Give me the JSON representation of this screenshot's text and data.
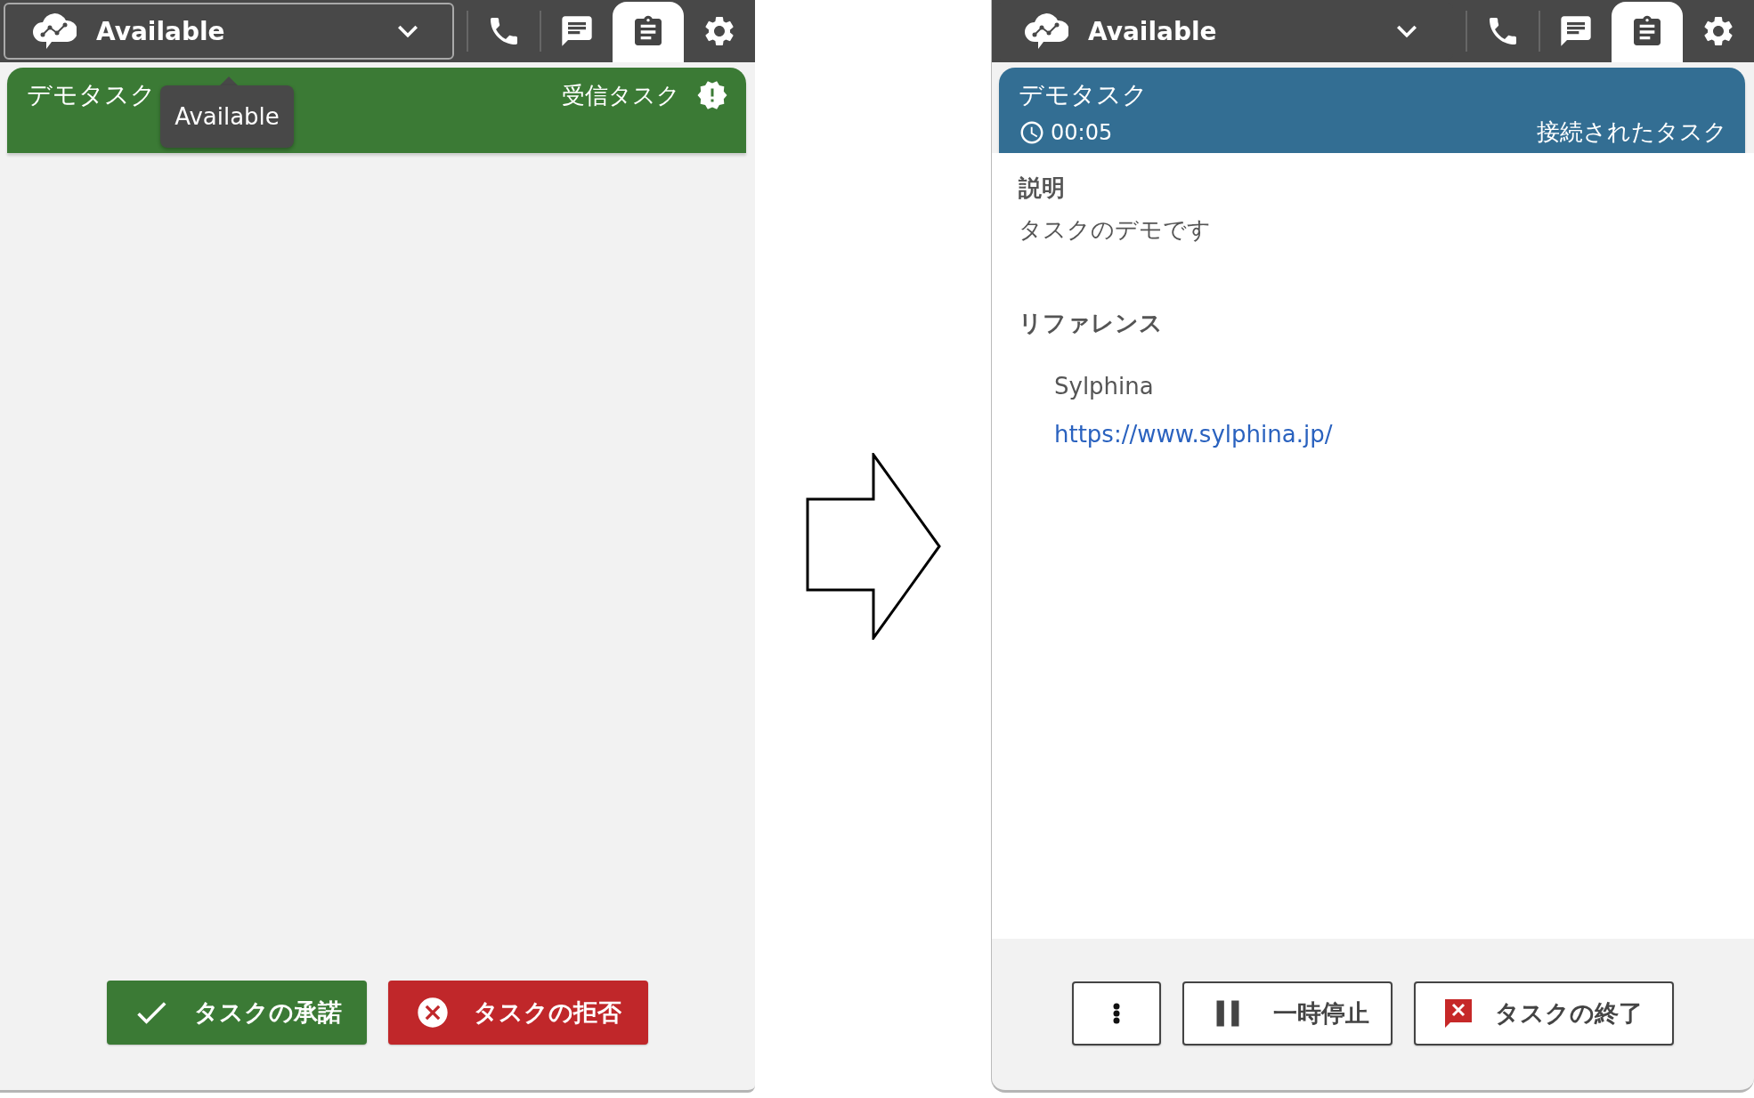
{
  "panels": [
    {
      "kind": "incoming",
      "status": {
        "label": "Available",
        "focused": true,
        "tooltip": "Available"
      },
      "tabs": [
        {
          "kind": "phone",
          "selected": false
        },
        {
          "kind": "chat",
          "selected": false
        },
        {
          "kind": "task",
          "selected": true
        },
        {
          "kind": "settings",
          "selected": false
        }
      ],
      "task": {
        "title": "デモタスク",
        "state": "受信タスク"
      },
      "actions": [
        {
          "kind": "accept",
          "label": "タスクの承諾"
        },
        {
          "kind": "reject",
          "label": "タスクの拒否"
        }
      ]
    },
    {
      "kind": "connected",
      "status": {
        "label": "Available",
        "focused": false
      },
      "tabs": [
        {
          "kind": "phone",
          "selected": false
        },
        {
          "kind": "chat",
          "selected": false
        },
        {
          "kind": "task",
          "selected": true
        },
        {
          "kind": "settings",
          "selected": false
        }
      ],
      "task": {
        "title": "デモタスク",
        "timer": "00:05",
        "state": "接続されたタスク"
      },
      "details": {
        "description_label": "説明",
        "description": "タスクのデモです",
        "references_label": "リファレンス",
        "references": [
          {
            "name": "Sylphina",
            "url": "https://www.sylphina.jp/"
          }
        ]
      },
      "actions": [
        {
          "kind": "more"
        },
        {
          "kind": "pause",
          "label": "一時停止"
        },
        {
          "kind": "end",
          "label": "タスクの終了"
        }
      ]
    }
  ]
}
